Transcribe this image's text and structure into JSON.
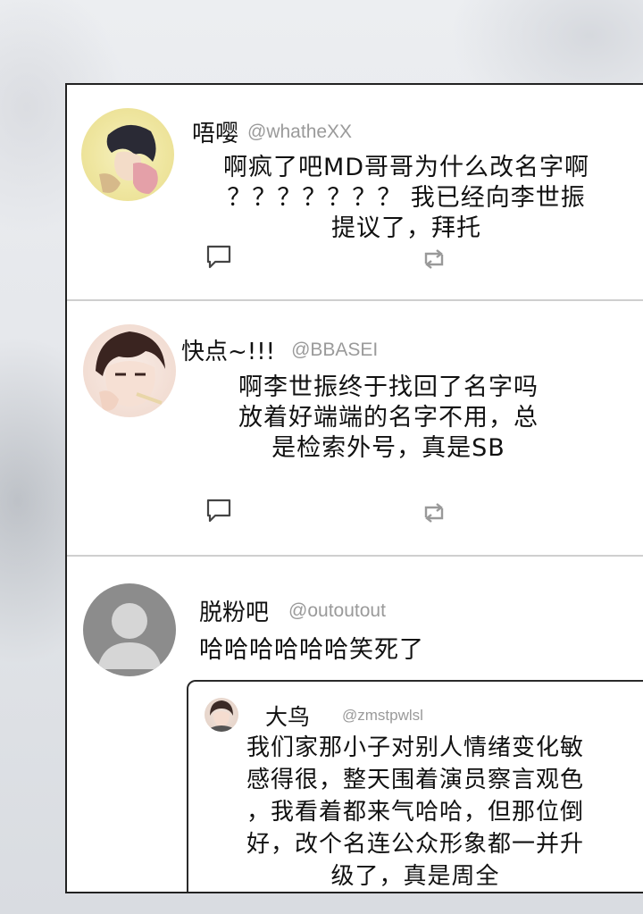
{
  "posts": [
    {
      "display_name": "唔嘤",
      "handle": "@whatheXX",
      "text_lines": [
        "啊疯了吧MD哥哥为什么改名字啊",
        "？？？？？？？ 我已经向李世振",
        "提议了，拜托"
      ],
      "avatar_icon": "anime-avatar"
    },
    {
      "display_name": "快点~!!!",
      "handle": "@BBASEI",
      "text_lines": [
        "啊李世振终于找回了名字吗",
        "放着好端端的名字不用，总",
        "是检索外号，真是SB"
      ],
      "avatar_icon": "anime-avatar"
    },
    {
      "display_name": "脱粉吧",
      "handle": "@outoutout",
      "text_lines": [
        "哈哈哈哈哈哈笑死了"
      ],
      "avatar_icon": "default-user-avatar",
      "quoted": {
        "display_name": "大鸟",
        "handle": "@zmstpwlsl",
        "text_lines": [
          "我们家那小子对别人情绪变化敏",
          "感得很，整天围着演员察言观色",
          "，我看着都来气哈哈，但那位倒",
          "好，改个名连公众形象都一并升",
          "级了，真是周全"
        ],
        "avatar_icon": "anime-avatar"
      }
    }
  ],
  "actions": {
    "reply_icon": "reply-icon",
    "retweet_icon": "retweet-icon"
  },
  "colors": {
    "handle": "#9a9a9a",
    "text": "#111111",
    "border": "#222222",
    "divider": "#cfcfcf"
  }
}
